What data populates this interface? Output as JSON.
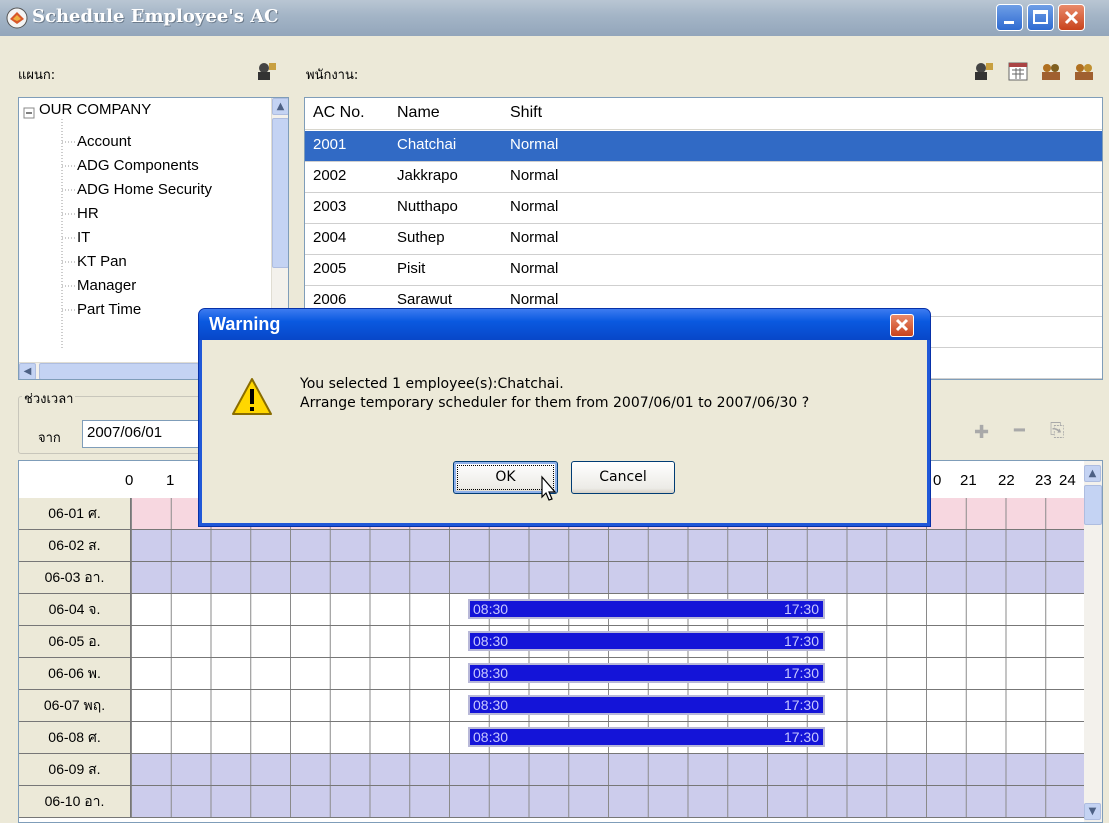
{
  "window": {
    "title": "Schedule Employee's AC"
  },
  "department_label": "แผนก:",
  "employee_label": "พนักงาน:",
  "tree": {
    "root": "OUR COMPANY",
    "items": [
      "Account",
      "ADG Components",
      "ADG Home Security",
      "HR",
      "IT",
      "KT Pan",
      "Manager",
      "Part Time"
    ]
  },
  "employee_table": {
    "columns": [
      "AC No.",
      "Name",
      "Shift"
    ],
    "rows": [
      {
        "ac": "2001",
        "name": "Chatchai",
        "shift": "Normal"
      },
      {
        "ac": "2002",
        "name": "Jakkrapo",
        "shift": "Normal"
      },
      {
        "ac": "2003",
        "name": "Nutthapo",
        "shift": "Normal"
      },
      {
        "ac": "2004",
        "name": "Suthep",
        "shift": "Normal"
      },
      {
        "ac": "2005",
        "name": "Pisit",
        "shift": "Normal"
      },
      {
        "ac": "2006",
        "name": "Sarawut",
        "shift": "Normal"
      }
    ],
    "selected_index": 0
  },
  "time_range": {
    "group_label": "ช่วงเวลา",
    "from_label": "จาก",
    "from_value": "2007/06/01"
  },
  "schedule": {
    "hours_left": [
      "0",
      "1"
    ],
    "hours_right": [
      "21",
      "22",
      "23",
      "24"
    ],
    "hour_fragment": "0",
    "days": [
      {
        "label": "06-01 ศ.",
        "type": "pink"
      },
      {
        "label": "06-02 ส.",
        "type": "weekend"
      },
      {
        "label": "06-03 อา.",
        "type": "weekend"
      },
      {
        "label": "06-04 จ.",
        "type": "work",
        "start": "08:30",
        "end": "17:30"
      },
      {
        "label": "06-05 อ.",
        "type": "work",
        "start": "08:30",
        "end": "17:30"
      },
      {
        "label": "06-06 พ.",
        "type": "work",
        "start": "08:30",
        "end": "17:30"
      },
      {
        "label": "06-07 พฤ.",
        "type": "work",
        "start": "08:30",
        "end": "17:30"
      },
      {
        "label": "06-08 ศ.",
        "type": "work",
        "start": "08:30",
        "end": "17:30"
      },
      {
        "label": "06-09 ส.",
        "type": "weekend"
      },
      {
        "label": "06-10 อา.",
        "type": "weekend"
      }
    ]
  },
  "dialog": {
    "title": "Warning",
    "line1": "You selected 1 employee(s):Chatchai.",
    "line2": "Arrange temporary scheduler for them from 2007/06/01 to 2007/06/30 ?",
    "ok": "OK",
    "cancel": "Cancel"
  },
  "icons": [
    "app-icon",
    "department-tool-icon",
    "employee-tool-icon",
    "calendar-icon",
    "group-icon",
    "group-remove-icon",
    "add-icon",
    "remove-icon",
    "copy-icon",
    "warning-icon",
    "cursor-icon"
  ],
  "colors": {
    "selection": "#316ac5",
    "shift_bar": "#1414d8",
    "weekend": "#ccccec",
    "holiday": "#f7d7e0",
    "dialog_title": "#0a59e0"
  }
}
